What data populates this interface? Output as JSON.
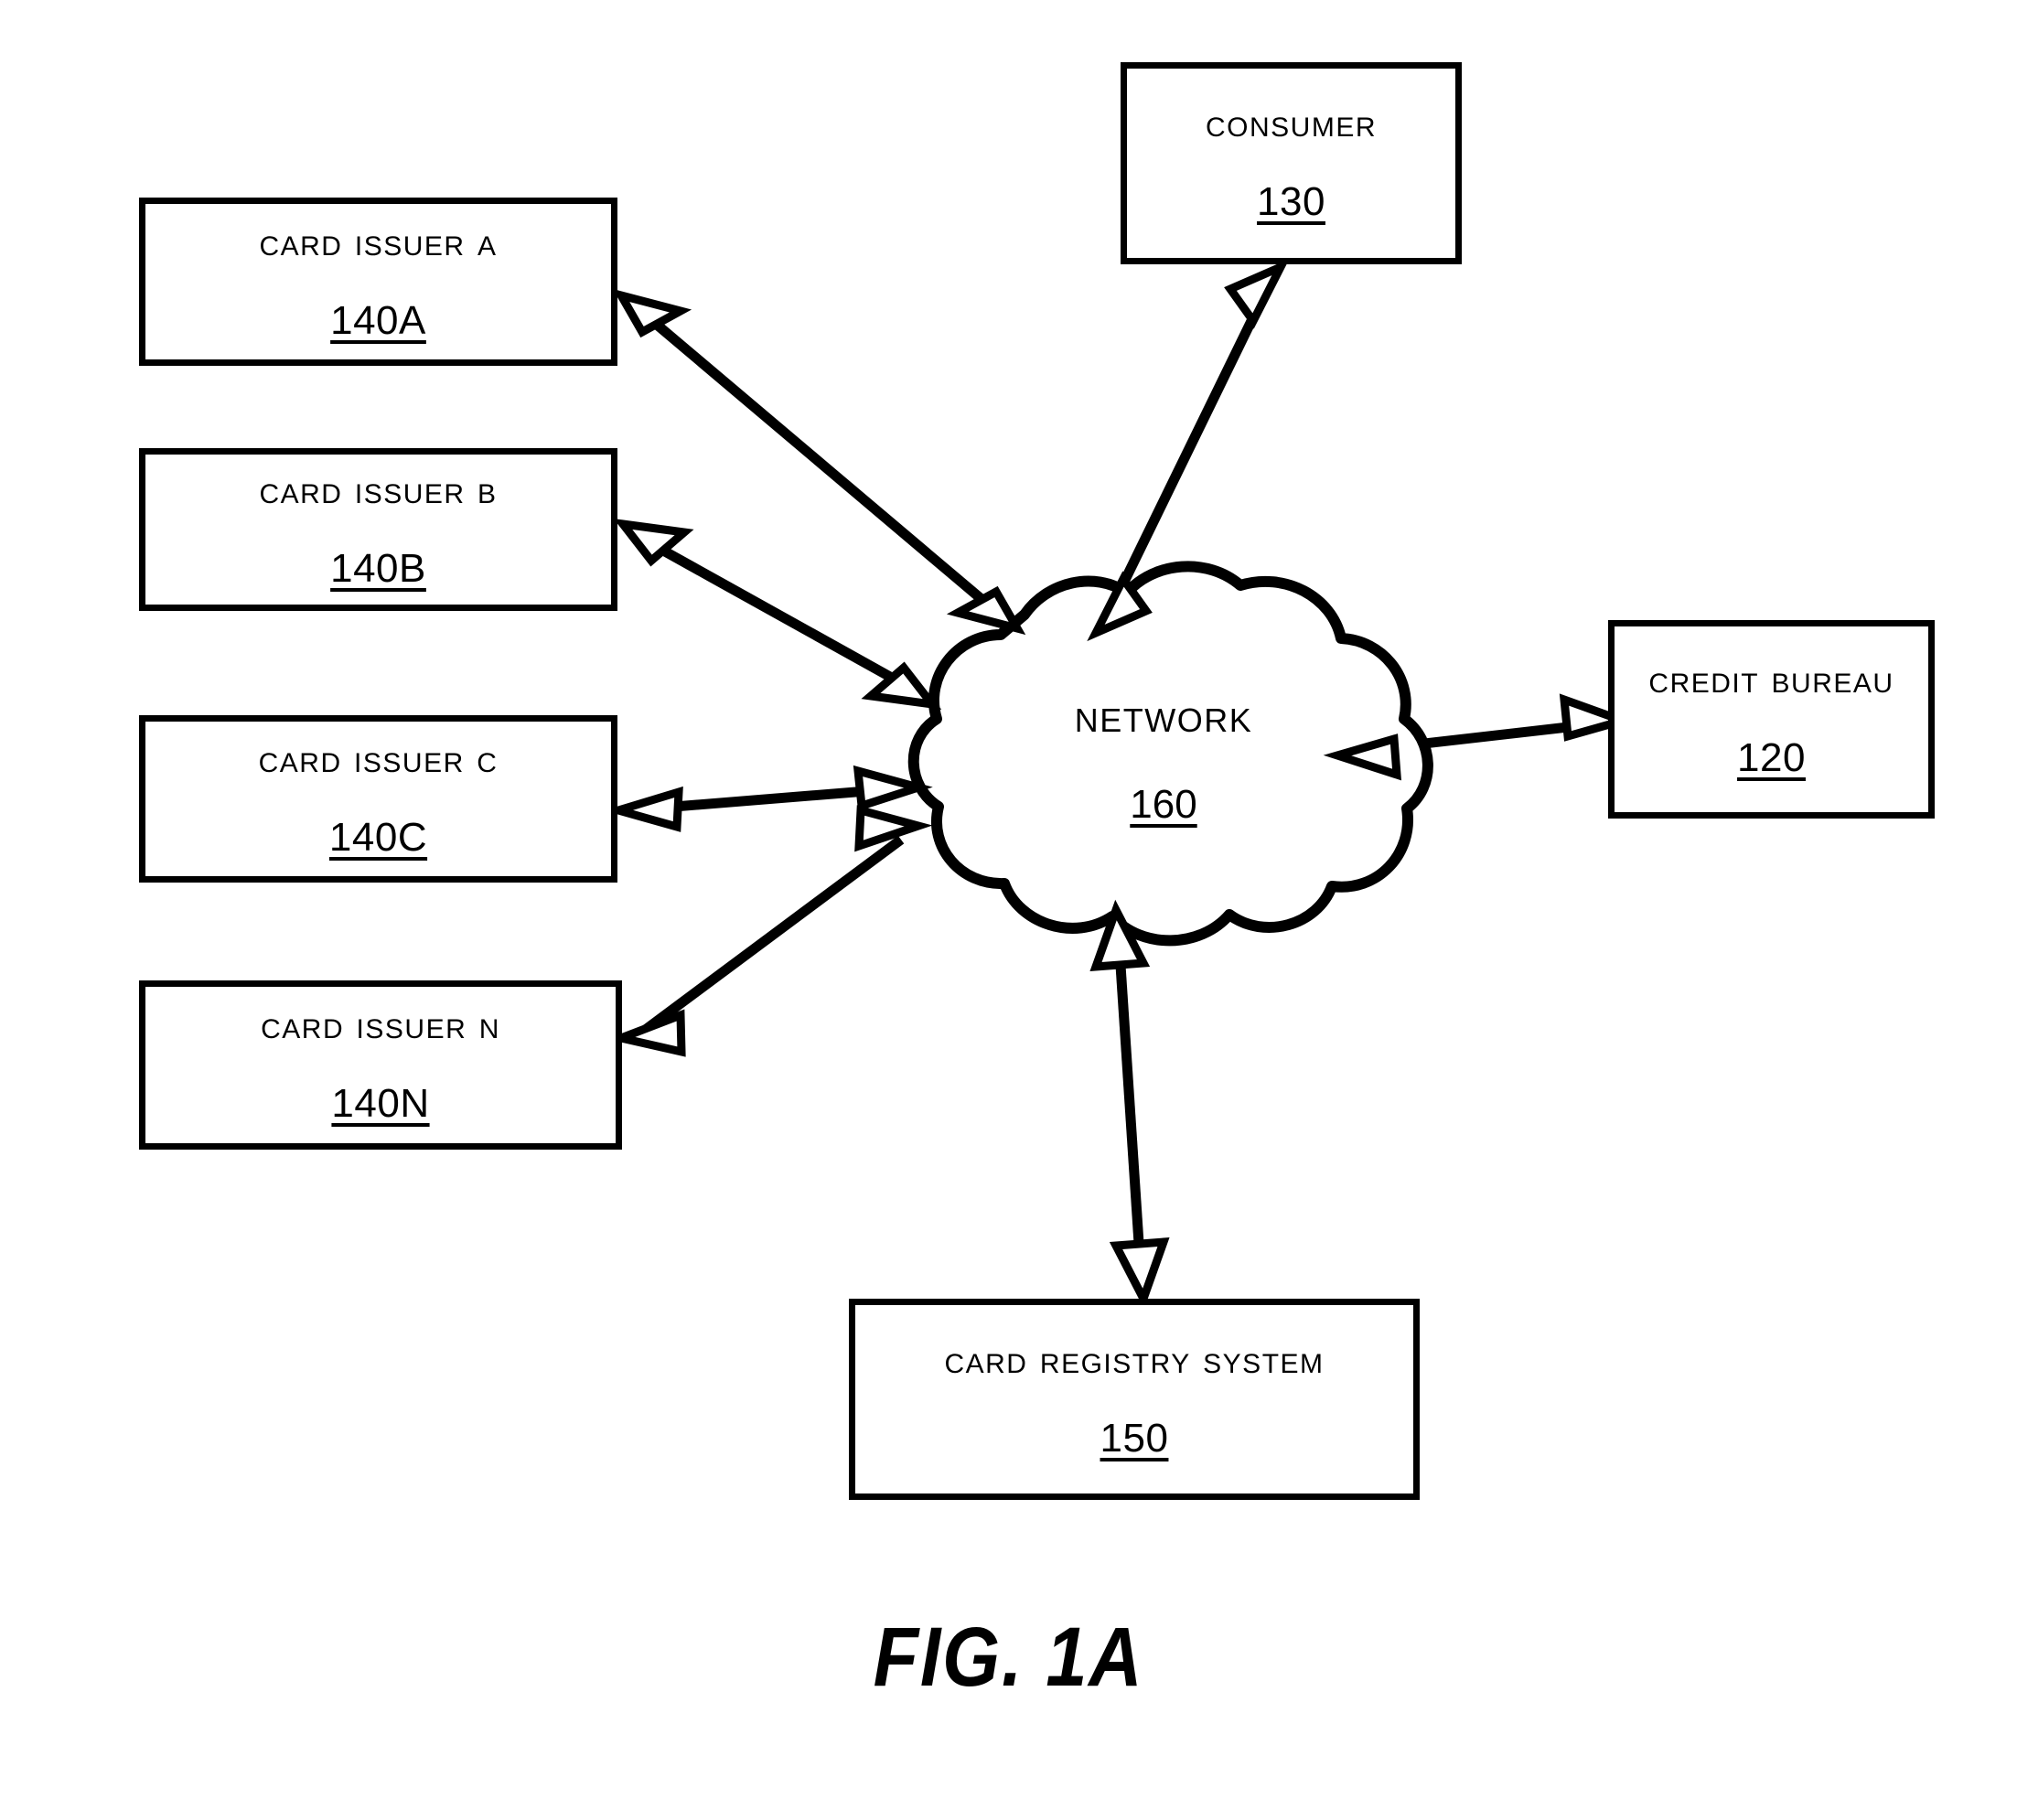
{
  "figure": {
    "caption": "FIG. 1A",
    "line_color": "#000000",
    "background_color": "#ffffff"
  },
  "nodes": {
    "card_issuer_a": {
      "title": "Card Issuer A",
      "ref": "140A"
    },
    "card_issuer_b": {
      "title": "Card Issuer B",
      "ref": "140B"
    },
    "card_issuer_c": {
      "title": "Card Issuer C",
      "ref": "140C"
    },
    "card_issuer_n": {
      "title": "Card Issuer N",
      "ref": "140N"
    },
    "consumer": {
      "title": "Consumer",
      "ref": "130"
    },
    "credit_bureau": {
      "title": "Credit Bureau",
      "ref": "120"
    },
    "card_registry_system": {
      "title": "Card Registry System",
      "ref": "150"
    },
    "network": {
      "title": "NETWORK",
      "ref": "160"
    }
  },
  "connections": [
    {
      "name": "card-issuer-a-to-network",
      "from": "card_issuer_a",
      "to": "network",
      "arrowheads": "both"
    },
    {
      "name": "card-issuer-b-to-network",
      "from": "card_issuer_b",
      "to": "network",
      "arrowheads": "both"
    },
    {
      "name": "card-issuer-c-to-network",
      "from": "card_issuer_c",
      "to": "network",
      "arrowheads": "both"
    },
    {
      "name": "card-issuer-n-to-network",
      "from": "card_issuer_n",
      "to": "network",
      "arrowheads": "both"
    },
    {
      "name": "consumer-to-network",
      "from": "consumer",
      "to": "network",
      "arrowheads": "both"
    },
    {
      "name": "credit-bureau-to-network",
      "from": "credit_bureau",
      "to": "network",
      "arrowheads": "both"
    },
    {
      "name": "card-registry-system-to-network",
      "from": "card_registry_system",
      "to": "network",
      "arrowheads": "both"
    }
  ]
}
